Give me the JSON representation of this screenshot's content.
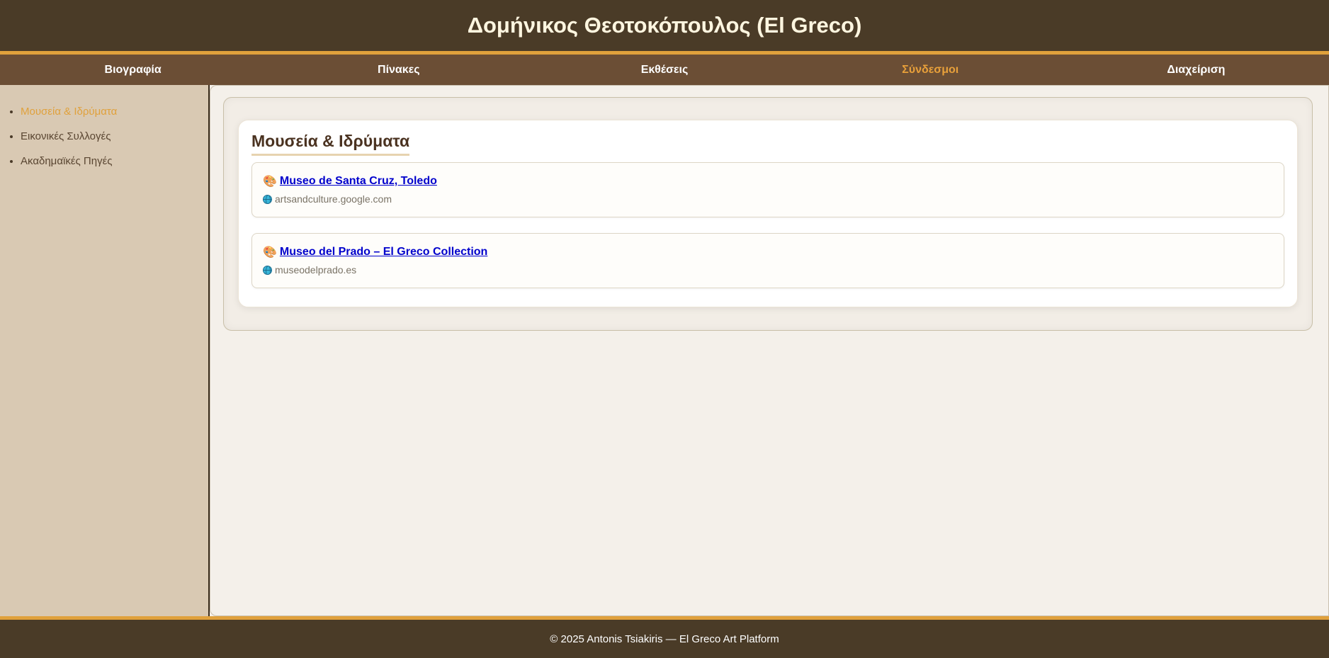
{
  "header": {
    "title": "Δομήνικος Θεοτοκόπουλος (El Greco)"
  },
  "nav": {
    "items": [
      {
        "label": "Βιογραφία"
      },
      {
        "label": "Πίνακες"
      },
      {
        "label": "Εκθέσεις"
      },
      {
        "label": "Σύνδεσμοι"
      },
      {
        "label": "Διαχείριση"
      }
    ],
    "active": "Σύνδεσμοι"
  },
  "sidebar": {
    "items": [
      {
        "label": "Μουσεία & Ιδρύματα"
      },
      {
        "label": "Εικονικές Συλλογές"
      },
      {
        "label": "Ακαδημαϊκές Πηγές"
      }
    ],
    "active": "Μουσεία & Ιδρύματα"
  },
  "main": {
    "section_title": "Μουσεία & Ιδρύματα",
    "links": [
      {
        "icon": "🎨",
        "title": "Museo de Santa Cruz, Toledo",
        "domain": "artsandculture.google.com"
      },
      {
        "icon": "🎨",
        "title": "Museo del Prado – El Greco Collection",
        "domain": "museodelprado.es"
      }
    ]
  },
  "icons": {
    "link": "palette-icon",
    "domain": "globe-icon"
  },
  "colors": {
    "accent": "#e0a13c",
    "header_bg": "#4a3b27",
    "nav_bg": "#6b4e35",
    "sidebar_bg": "#d9c9b3",
    "link": "#0000cc"
  },
  "footer": {
    "text": "© 2025 Antonis Tsiakiris — El Greco Art Platform"
  }
}
